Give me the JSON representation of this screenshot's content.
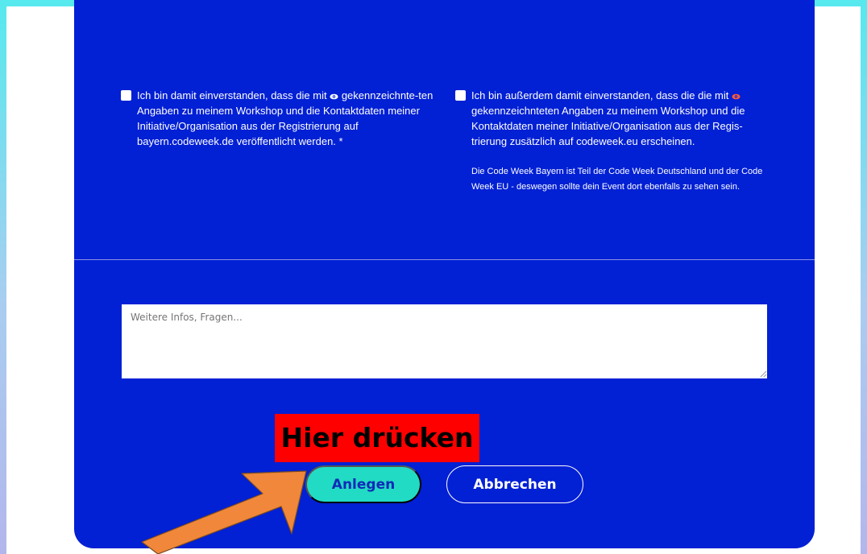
{
  "consent": {
    "left_text_part1": "Ich bin damit einverstanden, dass die mit",
    "left_text_part2": "gekennzeichnte-ten Angaben zu meinem Workshop und die Kontaktdaten meiner Initiative/Organisation aus der Registrierung auf bayern.codeweek.de veröffentlicht werden. *",
    "right_text_part1": "Ich bin außerdem damit einverstanden, dass die die mit",
    "right_text_part2": "gekennzeichnteten Angaben zu meinem Workshop und die Kontaktdaten meiner Initiative/Organisation aus der Regis-trierung zusätzlich auf codeweek.eu erscheinen.",
    "right_note": "Die Code Week Bayern ist Teil der Code Week Deutschland und der Code Week EU - deswegen sollte dein Event dort ebenfalls zu sehen sein.",
    "left_eye_icon": "eye-icon-white",
    "right_eye_icon": "eye-icon-red"
  },
  "comment": {
    "placeholder": "Weitere Infos, Fragen..."
  },
  "annotation": {
    "hint_label": "Hier drücken",
    "arrow_icon": "arrow-icon",
    "arrow_color": "#f0873a"
  },
  "buttons": {
    "submit_label": "Anlegen",
    "cancel_label": "Abbrechen"
  },
  "colors": {
    "form_background": "#0220d4",
    "primary_button": "#22dbc4",
    "hint_background": "#ff0000"
  }
}
